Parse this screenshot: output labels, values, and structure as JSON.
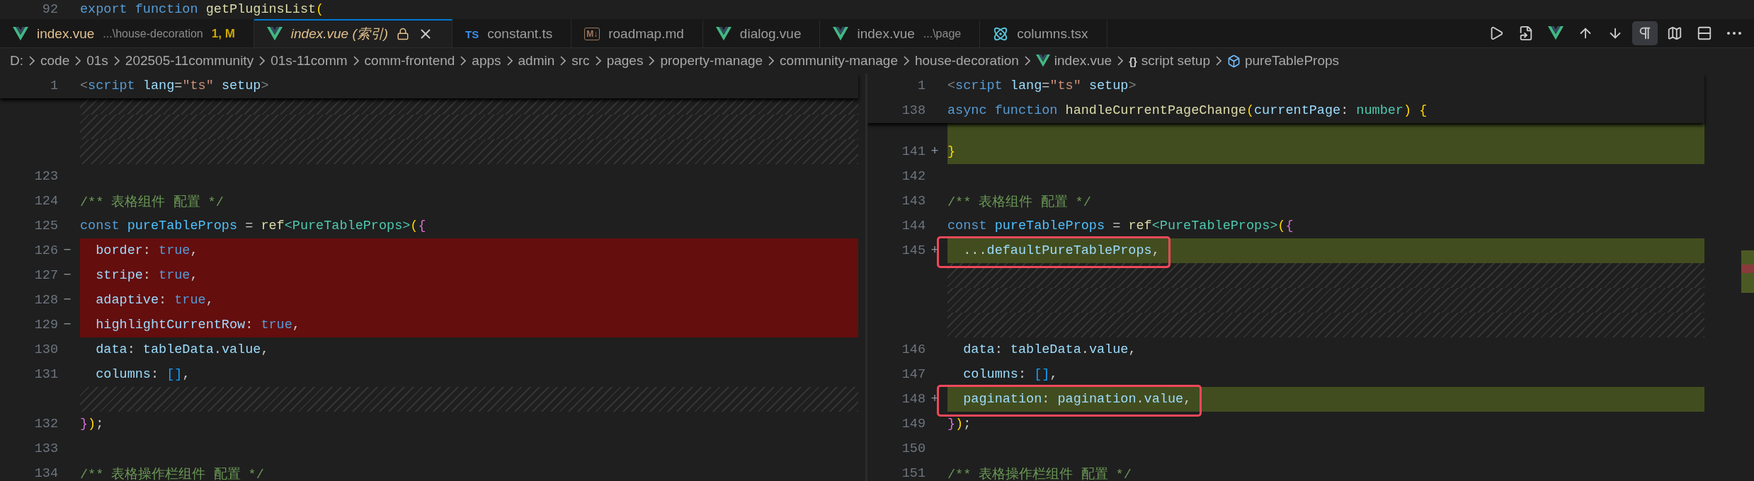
{
  "peek_line": {
    "num": "92",
    "text": "export function getPluginsList("
  },
  "tabs": [
    {
      "kind": "vue",
      "label": "index.vue",
      "description": "...\\house-decoration",
      "badge": "1, M",
      "warning": true,
      "preview": false,
      "locked": false,
      "closable": false,
      "selected": false
    },
    {
      "kind": "vue",
      "label": "index.vue (索引)",
      "warning": true,
      "preview": true,
      "locked": true,
      "closable": true,
      "selected": true
    },
    {
      "kind": "ts",
      "icon_text": "TS",
      "label": "constant.ts",
      "warning": false,
      "preview": false,
      "locked": false,
      "closable": false,
      "selected": false
    },
    {
      "kind": "md",
      "icon_text": "M↓",
      "label": "roadmap.md",
      "warning": false,
      "preview": false,
      "locked": false,
      "closable": false,
      "selected": false
    },
    {
      "kind": "vue",
      "label": "dialog.vue",
      "warning": false,
      "preview": false,
      "locked": false,
      "closable": false,
      "selected": false
    },
    {
      "kind": "vue",
      "label": "index.vue",
      "description": "...\\page",
      "warning": false,
      "preview": false,
      "locked": false,
      "closable": false,
      "selected": false
    },
    {
      "kind": "react",
      "label": "columns.tsx",
      "warning": false,
      "preview": false,
      "locked": false,
      "closable": false,
      "selected": false
    }
  ],
  "toolbar": [
    {
      "kind": "run",
      "selected": false
    },
    {
      "kind": "open",
      "selected": false
    },
    {
      "kind": "vue",
      "selected": false
    },
    {
      "kind": "up",
      "selected": false
    },
    {
      "kind": "down",
      "selected": false
    },
    {
      "kind": "whitespace",
      "selected": true
    },
    {
      "kind": "map",
      "selected": false
    },
    {
      "kind": "split",
      "selected": false
    },
    {
      "kind": "more",
      "selected": false
    }
  ],
  "breadcrumbs": [
    {
      "kind": "folder",
      "label": "D:"
    },
    {
      "kind": "folder",
      "label": "code"
    },
    {
      "kind": "folder",
      "label": "01s"
    },
    {
      "kind": "folder",
      "label": "202505-11community"
    },
    {
      "kind": "folder",
      "label": "01s-11comm"
    },
    {
      "kind": "folder",
      "label": "comm-frontend"
    },
    {
      "kind": "folder",
      "label": "apps"
    },
    {
      "kind": "folder",
      "label": "admin"
    },
    {
      "kind": "folder",
      "label": "src"
    },
    {
      "kind": "folder",
      "label": "pages"
    },
    {
      "kind": "folder",
      "label": "property-manage"
    },
    {
      "kind": "folder",
      "label": "community-manage"
    },
    {
      "kind": "folder",
      "label": "house-decoration"
    },
    {
      "kind": "file",
      "label": "index.vue"
    },
    {
      "kind": "scope",
      "icon_text": "{}",
      "label": "script setup"
    },
    {
      "kind": "symbol",
      "label": "pureTableProps"
    }
  ],
  "left": {
    "sticky": [
      {
        "num": "1",
        "text": "<script lang=\"ts\" setup>"
      }
    ],
    "lines": [
      {
        "kind": "filler"
      },
      {
        "kind": "filler"
      },
      {
        "kind": "filler"
      },
      {
        "kind": "normal",
        "num": "123"
      },
      {
        "kind": "normal",
        "num": "124",
        "text": "/** 表格组件 配置 */"
      },
      {
        "kind": "normal",
        "num": "125",
        "text": "const pureTableProps = ref<PureTableProps>({"
      },
      {
        "kind": "removed",
        "num": "126",
        "sign": "−",
        "text": "  border: true,"
      },
      {
        "kind": "removed",
        "num": "127",
        "sign": "−",
        "text": "  stripe: true,"
      },
      {
        "kind": "removed",
        "num": "128",
        "sign": "−",
        "text": "  adaptive: true,"
      },
      {
        "kind": "removed",
        "num": "129",
        "sign": "−",
        "text": "  highlightCurrentRow: true,"
      },
      {
        "kind": "normal",
        "num": "130",
        "text": "  data: tableData.value,"
      },
      {
        "kind": "normal",
        "num": "131",
        "text": "  columns: [],"
      },
      {
        "kind": "filler"
      },
      {
        "kind": "normal",
        "num": "132",
        "text": "});"
      },
      {
        "kind": "normal",
        "num": "133"
      },
      {
        "kind": "normal",
        "num": "134",
        "text": "/** 表格操作栏组件 配置 */"
      }
    ]
  },
  "right": {
    "sticky": [
      {
        "num": "1",
        "text": "<script lang=\"ts\" setup>"
      },
      {
        "num": "138",
        "text": "async function handleCurrentPageChange(currentPage: number) {"
      }
    ],
    "lines": [
      {
        "kind": "added"
      },
      {
        "kind": "added",
        "num": "141",
        "sign": "+",
        "annotated": false,
        "text": "}"
      },
      {
        "kind": "normal",
        "num": "142"
      },
      {
        "kind": "normal",
        "num": "143",
        "annotated": false,
        "text": "/** 表格组件 配置 */"
      },
      {
        "kind": "normal",
        "num": "144",
        "annotated": false,
        "text": "const pureTableProps = ref<PureTableProps>({"
      },
      {
        "kind": "added",
        "num": "145",
        "sign": "+",
        "annotated": true,
        "text": "  ...defaultPureTableProps,"
      },
      {
        "kind": "filler"
      },
      {
        "kind": "filler"
      },
      {
        "kind": "filler"
      },
      {
        "kind": "normal",
        "num": "146",
        "annotated": false,
        "text": "  data: tableData.value,"
      },
      {
        "kind": "normal",
        "num": "147",
        "annotated": false,
        "text": "  columns: [],"
      },
      {
        "kind": "added",
        "num": "148",
        "sign": "+",
        "annotated": true,
        "text": "  pagination: pagination.value,"
      },
      {
        "kind": "normal",
        "num": "149",
        "annotated": false,
        "text": "});"
      },
      {
        "kind": "normal",
        "num": "150"
      },
      {
        "kind": "normal",
        "num": "151",
        "annotated": false,
        "text": "/** 表格操作栏组件 配置 */"
      }
    ]
  }
}
